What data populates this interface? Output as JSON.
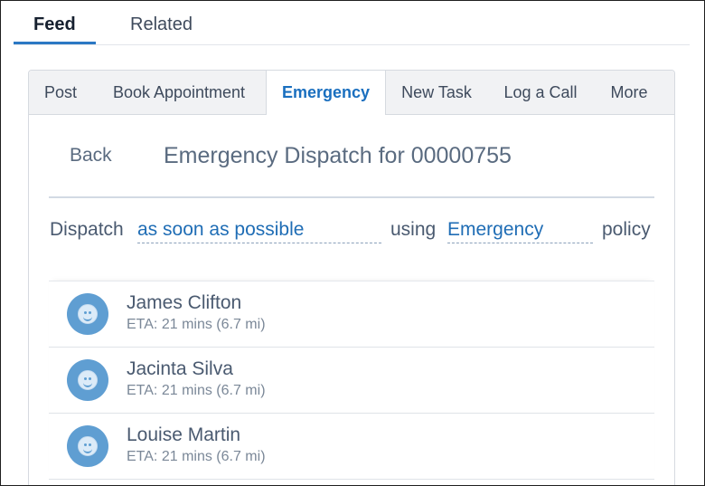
{
  "top_tabs": [
    {
      "label": "Feed",
      "active": true
    },
    {
      "label": "Related",
      "active": false
    }
  ],
  "action_tabs": [
    {
      "label": "Post"
    },
    {
      "label": "Book Appointment"
    },
    {
      "label": "Emergency",
      "active": true
    },
    {
      "label": "New Task"
    },
    {
      "label": "Log a Call"
    },
    {
      "label": "More"
    }
  ],
  "dispatch": {
    "back_label": "Back",
    "title": "Emergency Dispatch for 00000755",
    "prefix": "Dispatch",
    "when_value": "as soon as possible",
    "using_label": "using",
    "policy_value": "Emergency",
    "suffix": "policy"
  },
  "resources": [
    {
      "name": "James Clifton",
      "eta": "ETA: 21 mins (6.7 mi)"
    },
    {
      "name": "Jacinta Silva",
      "eta": "ETA: 21 mins (6.7 mi)"
    },
    {
      "name": "Louise Martin",
      "eta": "ETA: 21 mins (6.7 mi)"
    }
  ],
  "colors": {
    "accent": "#2b78c4",
    "link": "#1f6db5",
    "avatar": "#5f9ed2"
  }
}
